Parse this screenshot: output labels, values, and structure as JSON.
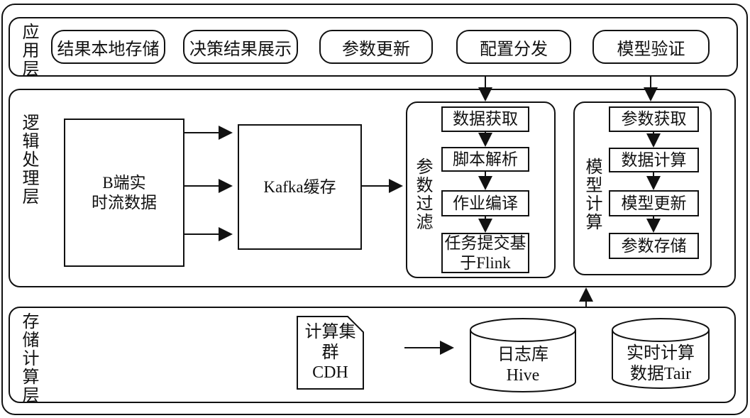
{
  "application_layer": {
    "label": "应用层",
    "items": [
      "结果本地存储",
      "决策结果展示",
      "参数更新",
      "配置分发",
      "模型验证"
    ]
  },
  "logic_layer": {
    "label": "逻辑处理层",
    "source": "B端实\n时流数据",
    "kafka": "Kafka缓存",
    "param_filter": {
      "label": "参数过滤",
      "steps": [
        "数据获取",
        "脚本解析",
        "作业编译",
        "任务提交基\n于Flink"
      ]
    },
    "model_compute": {
      "label": "模型计算",
      "steps": [
        "参数获取",
        "数据计算",
        "模型更新",
        "参数存储"
      ]
    }
  },
  "storage_layer": {
    "label": "存储计算层",
    "cluster": "计算集群\nCDH",
    "hive": "日志库\nHive",
    "tair": "实时计算\n数据Tair"
  }
}
